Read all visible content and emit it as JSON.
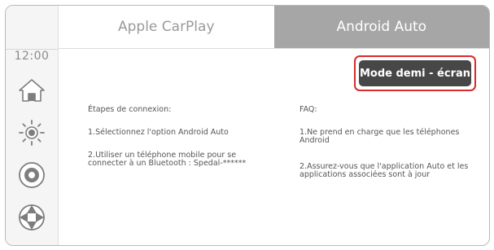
{
  "sidebar": {
    "time": "12:00",
    "icons": [
      "home-icon",
      "brightness-icon",
      "disc-icon",
      "aperture-icon"
    ]
  },
  "tabs": [
    {
      "label": "Apple CarPlay",
      "active": false
    },
    {
      "label": "Android Auto",
      "active": true
    }
  ],
  "mode_button": {
    "label": "Mode demi - écran",
    "highlight_color": "#d92b2b"
  },
  "steps": {
    "heading": "Étapes de connexion:",
    "items": [
      "1.Sélectionnez l'option Android Auto",
      "2.Utiliser un téléphone mobile pour se connecter à un Bluetooth :  Spedal-******"
    ]
  },
  "faq": {
    "heading": "FAQ:",
    "items": [
      "1.Ne prend en charge que les téléphones Android",
      "2.Assurez-vous que l'application Auto et les applications associées sont à jour"
    ]
  }
}
